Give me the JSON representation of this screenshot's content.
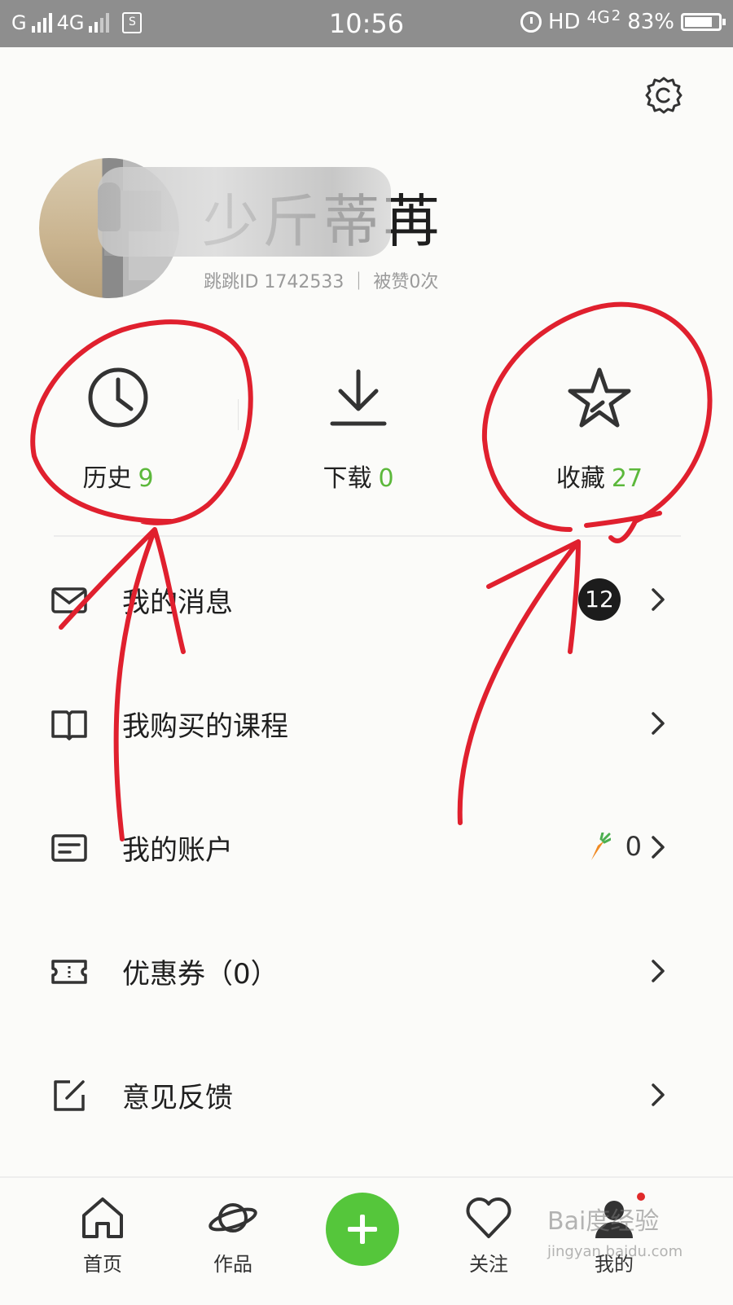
{
  "status_bar": {
    "carrier": "G",
    "network": "4G",
    "sim": "S",
    "time": "10:56",
    "hd_label": "HD",
    "network_right": "4G",
    "sim_slot": "2",
    "battery": "83%",
    "battery_fraction": 0.83
  },
  "profile": {
    "username": "少斤蒂苒",
    "id_line": "跳跳ID 1742533 ｜ 被赞0次"
  },
  "quick_actions": [
    {
      "label": "历史",
      "count": "9",
      "icon": "clock-icon"
    },
    {
      "label": "下载",
      "count": "0",
      "icon": "download-icon"
    },
    {
      "label": "收藏",
      "count": "27",
      "icon": "star-icon"
    }
  ],
  "menu": [
    {
      "label": "我的消息",
      "icon": "mail-icon",
      "badge": "12"
    },
    {
      "label": "我购买的课程",
      "icon": "book-icon"
    },
    {
      "label": "我的账户",
      "icon": "card-icon",
      "balance": "0"
    },
    {
      "label": "优惠券（0）",
      "icon": "coupon-icon"
    },
    {
      "label": "意见反馈",
      "icon": "edit-icon"
    }
  ],
  "bottom_nav": [
    {
      "label": "首页",
      "icon": "home-icon"
    },
    {
      "label": "作品",
      "icon": "planet-icon"
    },
    {
      "label": "",
      "icon": "plus-icon"
    },
    {
      "label": "关注",
      "icon": "heart-icon"
    },
    {
      "label": "我的",
      "icon": "profile-icon"
    }
  ],
  "watermark": {
    "line1": "Bai度经验",
    "line2": "jingyan.baidu.com"
  },
  "colors": {
    "accent_green": "#5cb83b",
    "annotation_red": "#e0202e"
  }
}
